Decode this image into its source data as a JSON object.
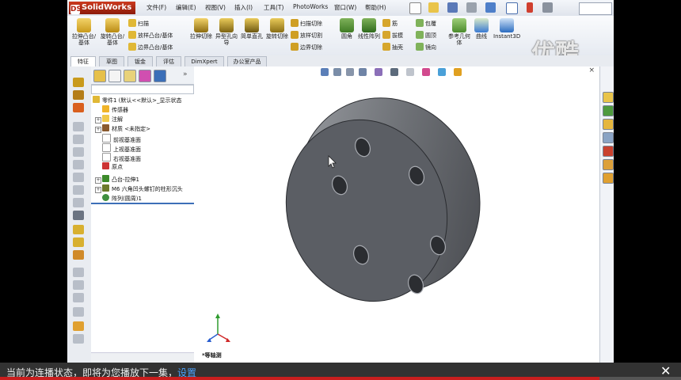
{
  "app": {
    "logo_text": "SolidWorks",
    "logo_badge": "DS"
  },
  "menu": [
    "文件(F)",
    "编辑(E)",
    "视图(V)",
    "插入(I)",
    "工具(T)",
    "PhotoWorks",
    "窗口(W)",
    "帮助(H)"
  ],
  "quick_access": [
    "new-icon",
    "open-icon",
    "save-icon",
    "print-icon",
    "undo-icon",
    "select-icon",
    "rebuild-icon",
    "options-icon"
  ],
  "watermark": "优酷",
  "commands": {
    "extrude_boss": "拉伸凸台/基体",
    "revolve_boss": "旋转凸台/基体",
    "sweep": "扫描",
    "loft": "放样凸台/基体",
    "boundary": "边界凸台/基体",
    "extrude_cut": "拉伸切除",
    "hole_wizard": "异型孔向导",
    "cut_extrude_hole": "简单直孔",
    "revolve_cut": "旋转切除",
    "sweep_cut": "扫描切除",
    "loft_cut": "放样切割",
    "boundary_cut": "边界切除",
    "fillet": "圆角",
    "linear_pattern": "线性阵列",
    "rib": "筋",
    "draft": "拔模",
    "shell": "抽壳",
    "wrap": "包覆",
    "dome": "圆顶",
    "mirror": "镜向",
    "ref_geometry": "参考几何体",
    "curves": "曲线",
    "instant3d": "Instant3D"
  },
  "tabs": [
    "特征",
    "草图",
    "钣金",
    "评估",
    "DimXpert",
    "办公室产品"
  ],
  "tree": {
    "root": "零件1  (默认<<默认>_显示状态",
    "items": [
      "传感器",
      "注解",
      "材质 <未指定>",
      "前视基准面",
      "上视基准面",
      "右视基准面",
      "原点",
      "凸台-拉伸1",
      "M6 六角凹头螺钉的柱形沉头",
      "阵列(圆周)1"
    ]
  },
  "viewport": {
    "view_label": "*等轴测",
    "close_glyph": "×"
  },
  "notification": {
    "text": "当前为连播状态，即将为您播放下一集，",
    "link": "设置",
    "close": "✕"
  },
  "progress": 0.88,
  "colors": {
    "accent": "#3d6fb8",
    "part_face": "#5b5e64",
    "brand": "#b3200e",
    "notify_bg": "#323232",
    "progress": "#c81e1e"
  }
}
